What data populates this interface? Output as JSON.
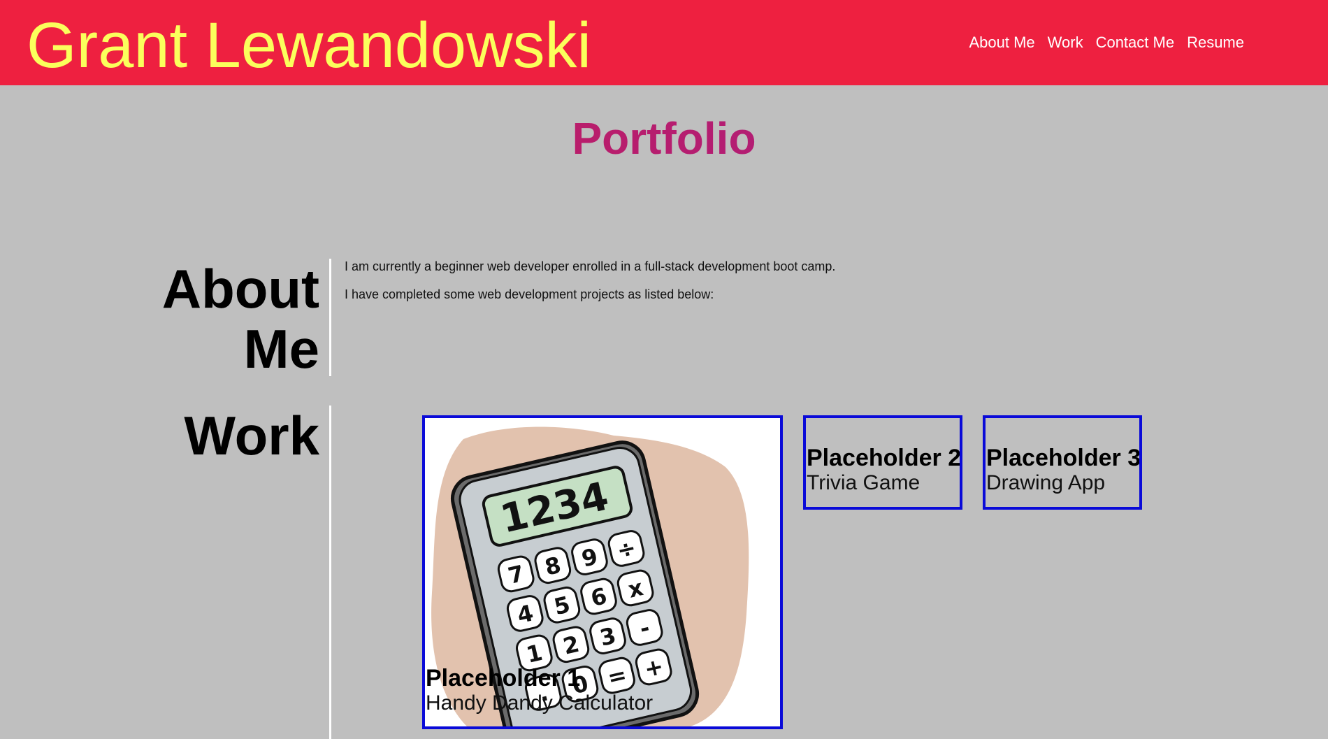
{
  "header": {
    "site_title": "Grant Lewandowski",
    "nav": [
      "About Me",
      "Work",
      "Contact Me",
      "Resume"
    ]
  },
  "main": {
    "title": "Portfolio",
    "about": {
      "heading_line1": "About",
      "heading_line2": "Me",
      "paragraphs": [
        "I am currently a beginner web developer enrolled in a full-stack development boot camp.",
        "I have completed some web development projects as listed below:"
      ]
    },
    "work": {
      "heading": "Work",
      "projects": [
        {
          "title": "Placeholder 1",
          "subtitle": "Handy Dandy Calculator",
          "display": "1234"
        },
        {
          "title": "Placeholder 2",
          "subtitle": "Trivia Game"
        },
        {
          "title": "Placeholder 3",
          "subtitle": "Drawing App"
        }
      ]
    }
  },
  "colors": {
    "header_bg": "#ee2040",
    "title_yellow": "#fbff5c",
    "page_bg": "#bfbfbf",
    "card_border": "#0a0ad8"
  }
}
